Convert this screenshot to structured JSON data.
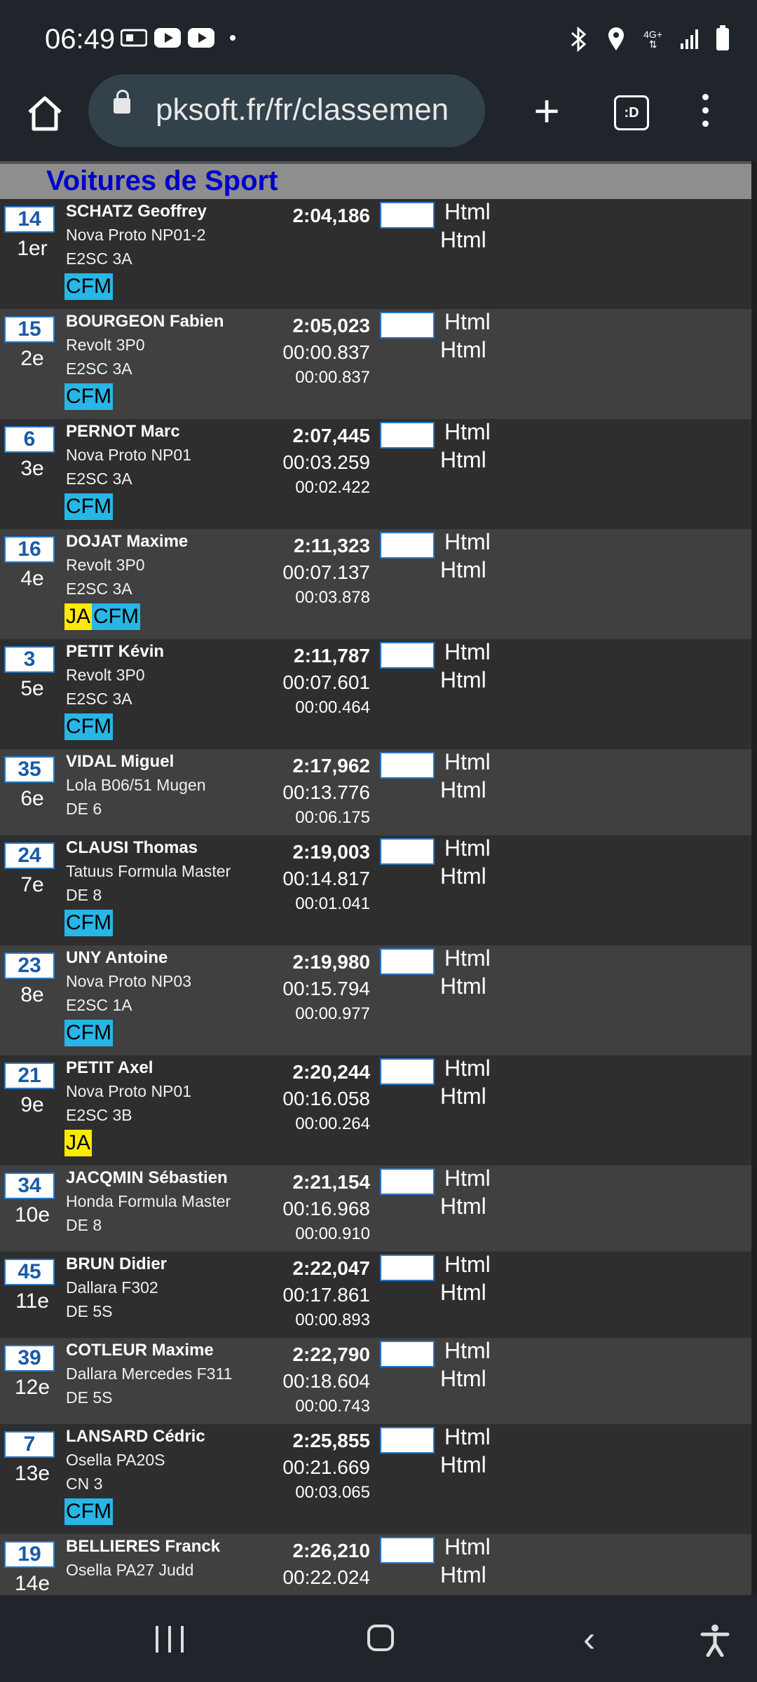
{
  "status_bar": {
    "time": "06:49",
    "network": "4G+"
  },
  "browser": {
    "url": "pksoft.fr/fr/classemen",
    "tabs_label": ":D"
  },
  "section": {
    "title": "Voitures de Sport"
  },
  "results": [
    {
      "num": "14",
      "pos": "1er",
      "name": "SCHATZ Geoffrey",
      "car": "Nova Proto NP01-2",
      "class": "E2SC 3A",
      "badges": [
        "CFM"
      ],
      "time": "2:04,186",
      "gap_leader": "",
      "gap_prev": "",
      "html1": "Html",
      "html2": "Html"
    },
    {
      "num": "15",
      "pos": "2e",
      "name": "BOURGEON Fabien",
      "car": "Revolt 3P0",
      "class": "E2SC 3A",
      "badges": [
        "CFM"
      ],
      "time": "2:05,023",
      "gap_leader": "00:00.837",
      "gap_prev": "00:00.837",
      "html1": "Html",
      "html2": "Html"
    },
    {
      "num": "6",
      "pos": "3e",
      "name": "PERNOT Marc",
      "car": "Nova Proto NP01",
      "class": "E2SC 3A",
      "badges": [
        "CFM"
      ],
      "time": "2:07,445",
      "gap_leader": "00:03.259",
      "gap_prev": "00:02.422",
      "html1": "Html",
      "html2": "Html"
    },
    {
      "num": "16",
      "pos": "4e",
      "name": "DOJAT Maxime",
      "car": "Revolt 3P0",
      "class": "E2SC 3A",
      "badges": [
        "JA",
        "CFM"
      ],
      "time": "2:11,323",
      "gap_leader": "00:07.137",
      "gap_prev": "00:03.878",
      "html1": "Html",
      "html2": "Html"
    },
    {
      "num": "3",
      "pos": "5e",
      "name": "PETIT Kévin",
      "car": "Revolt 3P0",
      "class": "E2SC 3A",
      "badges": [
        "CFM"
      ],
      "time": "2:11,787",
      "gap_leader": "00:07.601",
      "gap_prev": "00:00.464",
      "html1": "Html",
      "html2": "Html"
    },
    {
      "num": "35",
      "pos": "6e",
      "name": "VIDAL Miguel",
      "car": "Lola B06/51 Mugen",
      "class": "DE 6",
      "badges": [],
      "time": "2:17,962",
      "gap_leader": "00:13.776",
      "gap_prev": "00:06.175",
      "html1": "Html",
      "html2": "Html"
    },
    {
      "num": "24",
      "pos": "7e",
      "name": "CLAUSI Thomas",
      "car": "Tatuus Formula Master",
      "class": "DE 8",
      "badges": [
        "CFM"
      ],
      "time": "2:19,003",
      "gap_leader": "00:14.817",
      "gap_prev": "00:01.041",
      "html1": "Html",
      "html2": "Html"
    },
    {
      "num": "23",
      "pos": "8e",
      "name": "UNY Antoine",
      "car": "Nova Proto NP03",
      "class": "E2SC 1A",
      "badges": [
        "CFM"
      ],
      "time": "2:19,980",
      "gap_leader": "00:15.794",
      "gap_prev": "00:00.977",
      "html1": "Html",
      "html2": "Html"
    },
    {
      "num": "21",
      "pos": "9e",
      "name": "PETIT Axel",
      "car": "Nova Proto NP01",
      "class": "E2SC 3B",
      "badges": [
        "JA"
      ],
      "time": "2:20,244",
      "gap_leader": "00:16.058",
      "gap_prev": "00:00.264",
      "html1": "Html",
      "html2": "Html"
    },
    {
      "num": "34",
      "pos": "10e",
      "name": "JACQMIN Sébastien",
      "car": "Honda Formula Master",
      "class": "DE 8",
      "badges": [],
      "time": "2:21,154",
      "gap_leader": "00:16.968",
      "gap_prev": "00:00.910",
      "html1": "Html",
      "html2": "Html"
    },
    {
      "num": "45",
      "pos": "11e",
      "name": "BRUN Didier",
      "car": "Dallara F302",
      "class": "DE 5S",
      "badges": [],
      "time": "2:22,047",
      "gap_leader": "00:17.861",
      "gap_prev": "00:00.893",
      "html1": "Html",
      "html2": "Html"
    },
    {
      "num": "39",
      "pos": "12e",
      "name": "COTLEUR Maxime",
      "car": "Dallara Mercedes F311",
      "class": "DE 5S",
      "badges": [],
      "time": "2:22,790",
      "gap_leader": "00:18.604",
      "gap_prev": "00:00.743",
      "html1": "Html",
      "html2": "Html"
    },
    {
      "num": "7",
      "pos": "13e",
      "name": "LANSARD Cédric",
      "car": "Osella PA20S",
      "class": "CN 3",
      "badges": [
        "CFM"
      ],
      "time": "2:25,855",
      "gap_leader": "00:21.669",
      "gap_prev": "00:03.065",
      "html1": "Html",
      "html2": "Html"
    },
    {
      "num": "19",
      "pos": "14e",
      "name": "BELLIERES Franck",
      "car": "Osella PA27 Judd",
      "class": "",
      "badges": [],
      "time": "2:26,210",
      "gap_leader": "00:22.024",
      "gap_prev": "",
      "html1": "Html",
      "html2": "Html"
    }
  ],
  "colors": {
    "section_title": "#0000c8",
    "cfm_badge": "#27b6e6",
    "ja_badge": "#ffea00",
    "number_box_border": "#2a78c4"
  }
}
